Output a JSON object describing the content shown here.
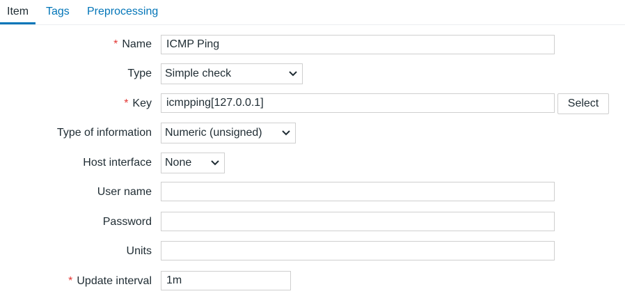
{
  "tabs": [
    {
      "label": "Item",
      "active": true
    },
    {
      "label": "Tags",
      "active": false
    },
    {
      "label": "Preprocessing",
      "active": false
    }
  ],
  "form": {
    "required_marker": "*",
    "name": {
      "label": "Name",
      "value": "ICMP Ping"
    },
    "type": {
      "label": "Type",
      "value": "Simple check"
    },
    "key": {
      "label": "Key",
      "value": "icmpping[127.0.0.1]",
      "button": "Select"
    },
    "type_of_information": {
      "label": "Type of information",
      "value": "Numeric (unsigned)"
    },
    "host_interface": {
      "label": "Host interface",
      "value": "None"
    },
    "user_name": {
      "label": "User name",
      "value": ""
    },
    "password": {
      "label": "Password",
      "value": ""
    },
    "units": {
      "label": "Units",
      "value": ""
    },
    "update_interval": {
      "label": "Update interval",
      "value": "1m"
    }
  },
  "colors": {
    "accent": "#0275b8",
    "required": "#e33734",
    "border": "#cfcfcf"
  }
}
